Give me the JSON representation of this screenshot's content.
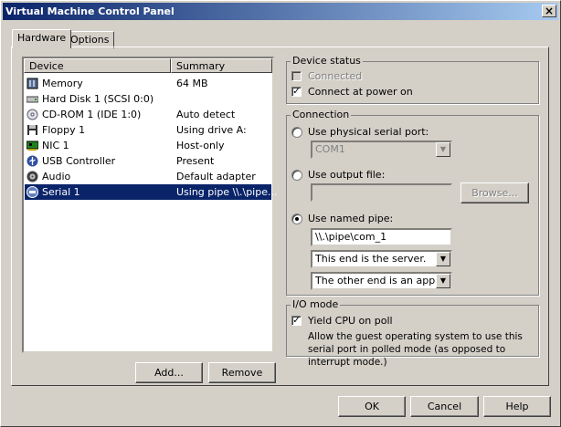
{
  "window": {
    "title": "Virtual Machine Control Panel",
    "close_glyph": "×"
  },
  "tabs": [
    {
      "label": "Hardware"
    },
    {
      "label": "Options"
    }
  ],
  "device_list": {
    "columns": {
      "device": "Device",
      "summary": "Summary"
    },
    "rows": [
      {
        "device": "Memory",
        "summary": "64 MB",
        "icon": "memory-icon"
      },
      {
        "device": "Hard Disk 1 (SCSI 0:0)",
        "summary": "",
        "icon": "hard-disk-icon"
      },
      {
        "device": "CD-ROM 1 (IDE 1:0)",
        "summary": "Auto detect",
        "icon": "cdrom-icon"
      },
      {
        "device": "Floppy 1",
        "summary": "Using drive A:",
        "icon": "floppy-icon"
      },
      {
        "device": "NIC 1",
        "summary": "Host-only",
        "icon": "nic-icon"
      },
      {
        "device": "USB Controller",
        "summary": "Present",
        "icon": "usb-icon"
      },
      {
        "device": "Audio",
        "summary": "Default adapter",
        "icon": "audio-icon"
      },
      {
        "device": "Serial 1",
        "summary": "Using pipe \\\\.\\pipe...",
        "icon": "serial-port-icon",
        "selected": true
      }
    ]
  },
  "list_buttons": {
    "add": "Add...",
    "remove": "Remove"
  },
  "device_status": {
    "title": "Device status",
    "connected": {
      "label": "Connected",
      "checked": false,
      "enabled": false
    },
    "connect_at_power_on": {
      "label": "Connect at power on",
      "checked": true
    }
  },
  "connection": {
    "title": "Connection",
    "physical_port": {
      "label": "Use physical serial port:",
      "selected": false,
      "value": "COM1"
    },
    "output_file": {
      "label": "Use output file:",
      "selected": false,
      "value": "",
      "browse": "Browse..."
    },
    "named_pipe": {
      "label": "Use named pipe:",
      "selected": true,
      "pipe_name": "\\\\.\\pipe\\com_1",
      "this_end": "This end is the server.",
      "other_end": "The other end is an application."
    }
  },
  "io_mode": {
    "title": "I/O mode",
    "yield_cpu": {
      "label": "Yield CPU on poll",
      "checked": true
    },
    "description": "Allow the guest operating system to use this serial port in polled mode (as opposed to interrupt mode.)"
  },
  "dialog_buttons": {
    "ok": "OK",
    "cancel": "Cancel",
    "help": "Help"
  },
  "colors": {
    "title_start": "#0a246a",
    "title_end": "#a6caf0",
    "face": "#d4d0c8",
    "selection": "#0a246a"
  }
}
